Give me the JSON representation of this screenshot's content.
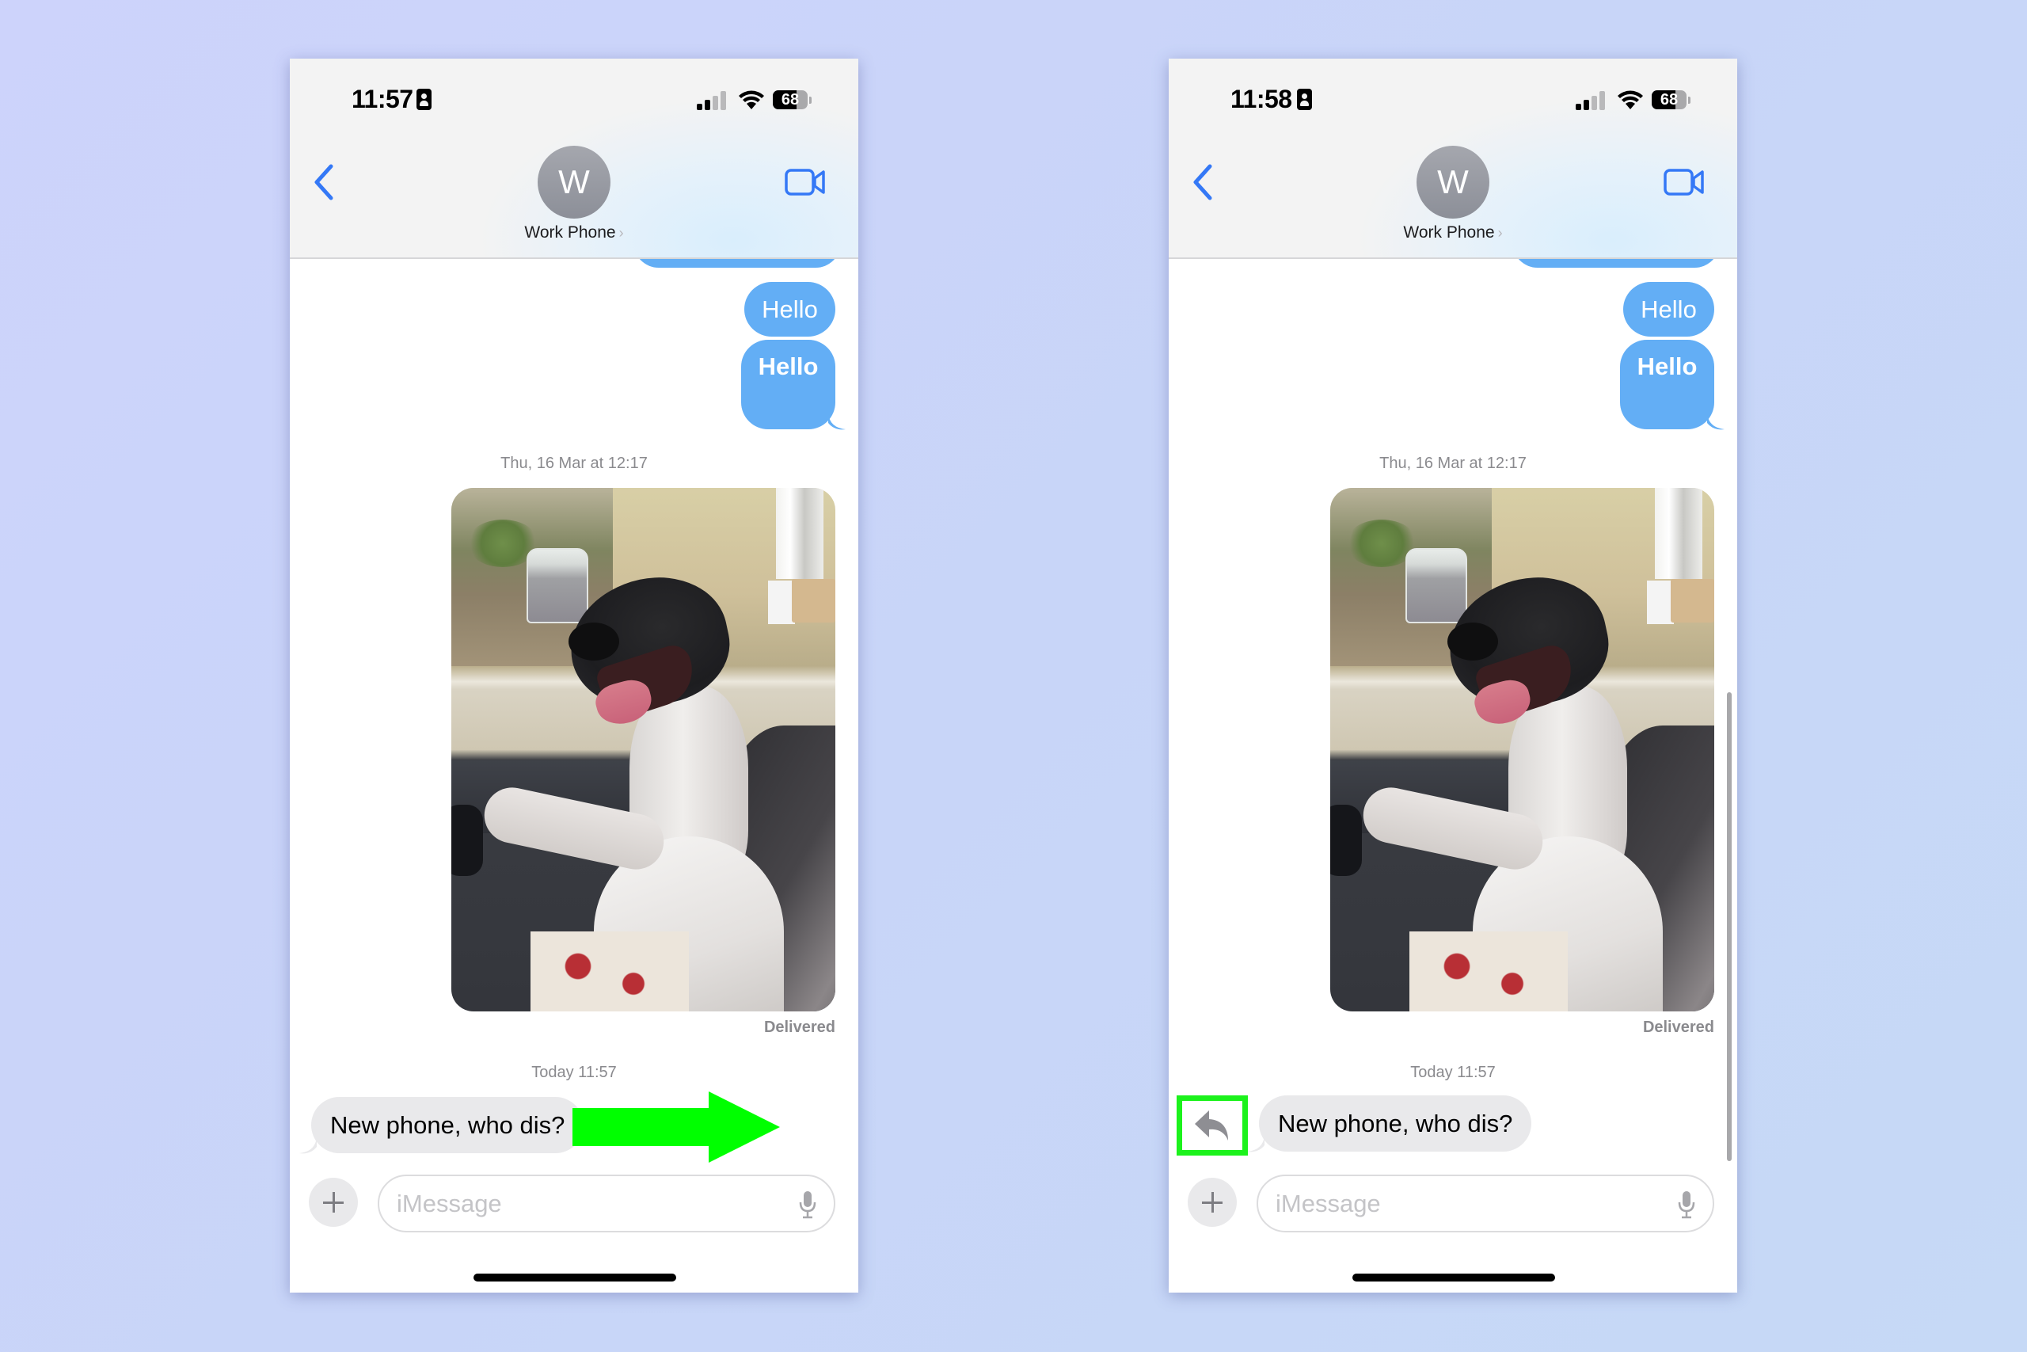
{
  "colors": {
    "background": "#C9D4F8",
    "ios_blue": "#3478F6",
    "sent_bubble": "#63AEF5",
    "received_bubble": "#E9E9EB",
    "highlight_green": "#1CF21C"
  },
  "phones": [
    {
      "status": {
        "time": "11:57",
        "battery": "68",
        "battery_level": 0.68,
        "signal_bars": 2,
        "signal_max": 4
      },
      "header": {
        "avatar_initial": "W",
        "contact_name": "Work Phone",
        "chevron": "›"
      },
      "messages": {
        "sent": [
          "Hello",
          "Hello"
        ],
        "timestamp_1": "Thu, 16 Mar at 12:17",
        "photo_alt": "Photo of a black and white greyhound smiling on a sofa",
        "delivered": "Delivered",
        "timestamp_2": "Today 11:57",
        "received": "New phone, who dis?"
      },
      "input": {
        "placeholder": "iMessage"
      },
      "annotation": "green-arrow-swipe-right"
    },
    {
      "status": {
        "time": "11:58",
        "battery": "68",
        "battery_level": 0.68,
        "signal_bars": 2,
        "signal_max": 4
      },
      "header": {
        "avatar_initial": "W",
        "contact_name": "Work Phone",
        "chevron": "›"
      },
      "messages": {
        "sent": [
          "Hello",
          "Hello"
        ],
        "timestamp_1": "Thu, 16 Mar at 12:17",
        "photo_alt": "Photo of a black and white greyhound smiling on a sofa",
        "delivered": "Delivered",
        "timestamp_2": "Today 11:57",
        "received": "New phone, who dis?"
      },
      "input": {
        "placeholder": "iMessage"
      },
      "annotation": "green-box-around-reply-icon"
    }
  ]
}
